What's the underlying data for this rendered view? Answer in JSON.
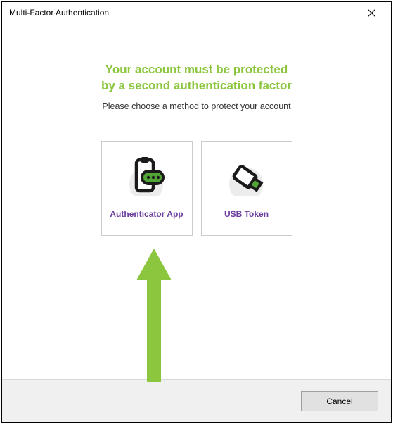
{
  "window": {
    "title": "Multi-Factor Authentication"
  },
  "heading": {
    "line1": "Your account must be protected",
    "line2": "by a second authentication factor"
  },
  "subtext": "Please choose a method to protect your account",
  "methods": {
    "authenticator": {
      "label": "Authenticator App"
    },
    "usb": {
      "label": "USB Token"
    }
  },
  "footer": {
    "cancel": "Cancel"
  },
  "colors": {
    "accent": "#8cc63f",
    "method_label": "#6a3c9c"
  }
}
